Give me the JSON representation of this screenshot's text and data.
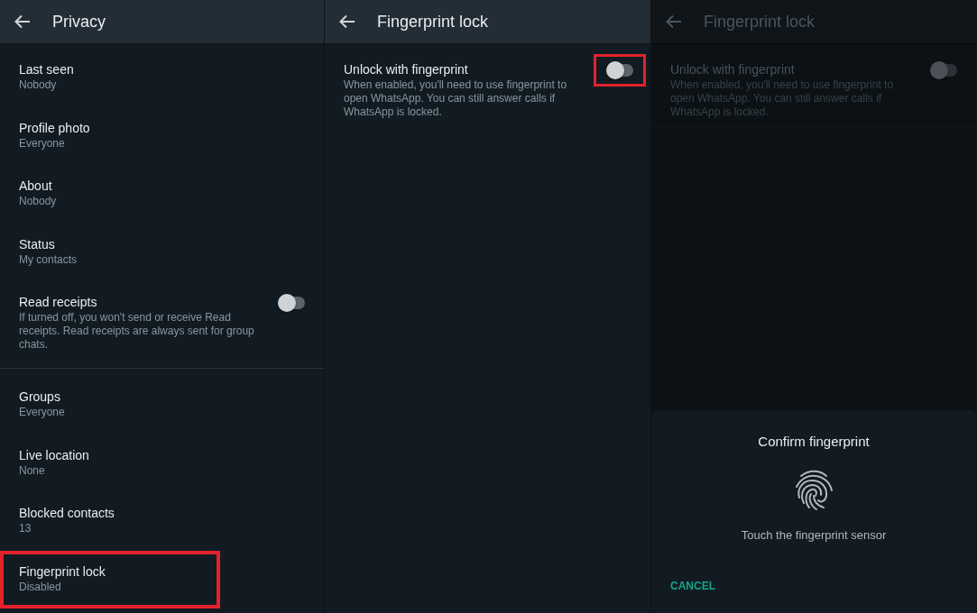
{
  "privacy_screen": {
    "title": "Privacy",
    "dimmed": false,
    "sections": [
      {
        "items": [
          {
            "kind": "link",
            "title": "Last seen",
            "subtitle": "Nobody",
            "highlighted": false
          },
          {
            "kind": "link",
            "title": "Profile photo",
            "subtitle": "Everyone",
            "highlighted": false
          },
          {
            "kind": "link",
            "title": "About",
            "subtitle": "Nobody",
            "highlighted": false
          },
          {
            "kind": "link",
            "title": "Status",
            "subtitle": "My contacts",
            "highlighted": false
          },
          {
            "kind": "toggle",
            "title": "Read receipts",
            "subtitle": "If turned off, you won't send or receive Read receipts. Read receipts are always sent for group chats.",
            "on": false,
            "highlighted": false
          }
        ]
      },
      {
        "items": [
          {
            "kind": "link",
            "title": "Groups",
            "subtitle": "Everyone",
            "highlighted": false
          },
          {
            "kind": "link",
            "title": "Live location",
            "subtitle": "None",
            "highlighted": false
          },
          {
            "kind": "link",
            "title": "Blocked contacts",
            "subtitle": "13",
            "highlighted": false
          },
          {
            "kind": "link",
            "title": "Fingerprint lock",
            "subtitle": "Disabled",
            "highlighted": true
          }
        ]
      }
    ]
  },
  "fingerprint_screen": {
    "title": "Fingerprint lock",
    "dimmed": false,
    "sections": [
      {
        "items": [
          {
            "kind": "toggle",
            "title": "Unlock with fingerprint",
            "subtitle": "When enabled, you'll need to use fingerprint to open WhatsApp. You can still answer calls if WhatsApp is locked.",
            "on": false,
            "highlighted": true
          }
        ]
      }
    ]
  },
  "fingerprint_dialog_screen": {
    "title": "Fingerprint lock",
    "dimmed": true,
    "sections": [
      {
        "items": [
          {
            "kind": "toggle",
            "title": "Unlock with fingerprint",
            "subtitle": "When enabled, you'll need to use fingerprint to open WhatsApp. You can still answer calls if WhatsApp is locked.",
            "on": false,
            "highlighted": false
          }
        ]
      }
    ],
    "dialog": {
      "title": "Confirm fingerprint",
      "message": "Touch the fingerprint sensor",
      "cancel_button": "CANCEL"
    }
  }
}
